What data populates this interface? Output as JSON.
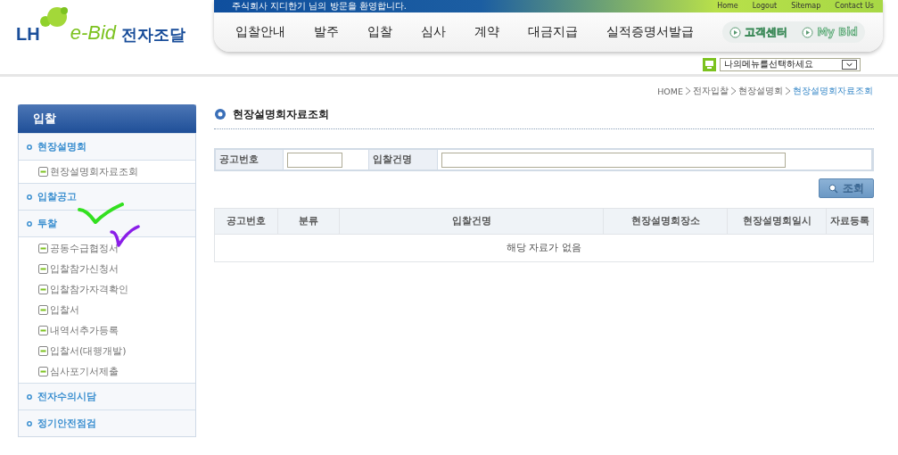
{
  "header": {
    "logo": {
      "brand": "LH",
      "product": "e-Bid",
      "name": "전자조달"
    },
    "welcome": "주식회사 지디한기 님의 방문을 환영합니다.",
    "top_links": [
      "Home",
      "Logout",
      "Sitemap",
      "Contact Us"
    ],
    "nav": [
      "입찰안내",
      "발주",
      "입찰",
      "심사",
      "계약",
      "대금지급",
      "실적증명서발급"
    ],
    "quick_links": [
      "고객센터",
      "My Bid"
    ],
    "my_menu": {
      "value": "나의메뉴를선택하세요"
    }
  },
  "breadcrumb": [
    {
      "label": "HOME",
      "selected": false
    },
    {
      "label": "전자입찰",
      "selected": false
    },
    {
      "label": "현장설명회",
      "selected": false
    },
    {
      "label": "현장설명회자료조회",
      "selected": true
    }
  ],
  "sidebar": {
    "title": "입찰",
    "sections": [
      {
        "label": "현장설명회",
        "children": [
          {
            "label": "현장설명회자료조회"
          }
        ]
      },
      {
        "label": "입찰공고"
      },
      {
        "label": "투찰",
        "children": [
          {
            "label": "공동수급협정서"
          },
          {
            "label": "입찰참가신청서"
          },
          {
            "label": "입찰참가자격확인"
          },
          {
            "label": "입찰서"
          },
          {
            "label": "내역서추가등록"
          },
          {
            "label": "입찰서(대행개발)"
          },
          {
            "label": "심사포기서제출"
          }
        ]
      },
      {
        "label": "전자수의시담"
      },
      {
        "label": "정기안전점검"
      }
    ]
  },
  "page_title": "현장설명회자료조회",
  "search": {
    "fields": [
      {
        "label": "공고번호",
        "kind": "short"
      },
      {
        "label": "입찰건명",
        "kind": "long"
      }
    ],
    "button": "조회"
  },
  "table": {
    "columns": [
      "공고번호",
      "분류",
      "입찰건명",
      "현장설명회장소",
      "현장설명회일시",
      "자료등록"
    ],
    "empty_message": "해당 자료가 없음"
  }
}
